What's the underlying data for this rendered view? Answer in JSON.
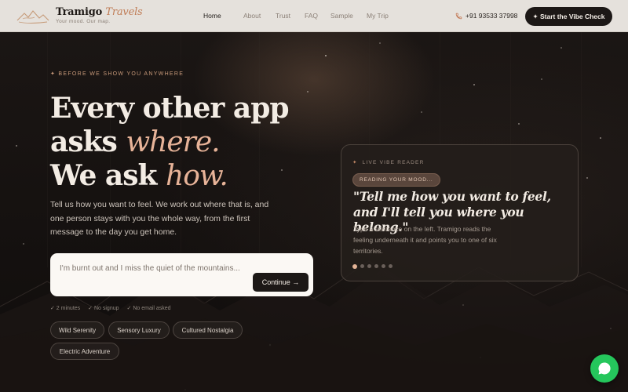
{
  "brand": {
    "name_primary": "Tramigo",
    "name_accent": "Travels",
    "tagline": "Your mood. Our map."
  },
  "nav": {
    "links": [
      "Home",
      "About",
      "Trust",
      "FAQ",
      "Sample",
      "My Trip"
    ],
    "active": "Home",
    "phone": "+91 93533 37998",
    "cta": "✦ Start the Vibe Check"
  },
  "hero": {
    "eyebrow": "✦ BEFORE WE SHOW YOU ANYWHERE",
    "headline_line1": "Every other app",
    "headline_line2a": "asks ",
    "headline_line2b": "where.",
    "headline_line3a": "We ask ",
    "headline_line3b": "how.",
    "lead": "Tell us how you want to feel. We work out where that is, and one person stays with you the whole way, from the first message to the day you get home.",
    "input_placeholder": "I'm burnt out and I miss the quiet of the mountains...",
    "continue_label": "Continue →",
    "checks": [
      "✓ 2 minutes",
      "✓ No signup",
      "✓ No email asked"
    ],
    "chips": [
      "Wild Serenity",
      "Sensory Luxury",
      "Cultured Nostalgia",
      "Electric Adventure"
    ]
  },
  "vibe_card": {
    "eyebrow_star": "✦",
    "eyebrow": "LIVE VIBE READER",
    "pill": "READING YOUR MOOD...",
    "quote": "\"Tell me how you want to feel, and I'll tell you where you belong.\"",
    "description": "Type a sentence on the left. Tramigo reads the feeling underneath it and points you to one of six territories.",
    "dots_total": 6,
    "dots_active": 0
  },
  "colors": {
    "accent": "#e7b398",
    "nav_bg": "#e5e1dc",
    "hero_bg": "#151110",
    "button_dark": "#1c1816",
    "whatsapp": "#25c65c"
  },
  "icons": [
    "logo-mountain-icon",
    "phone-icon",
    "whatsapp-icon"
  ]
}
